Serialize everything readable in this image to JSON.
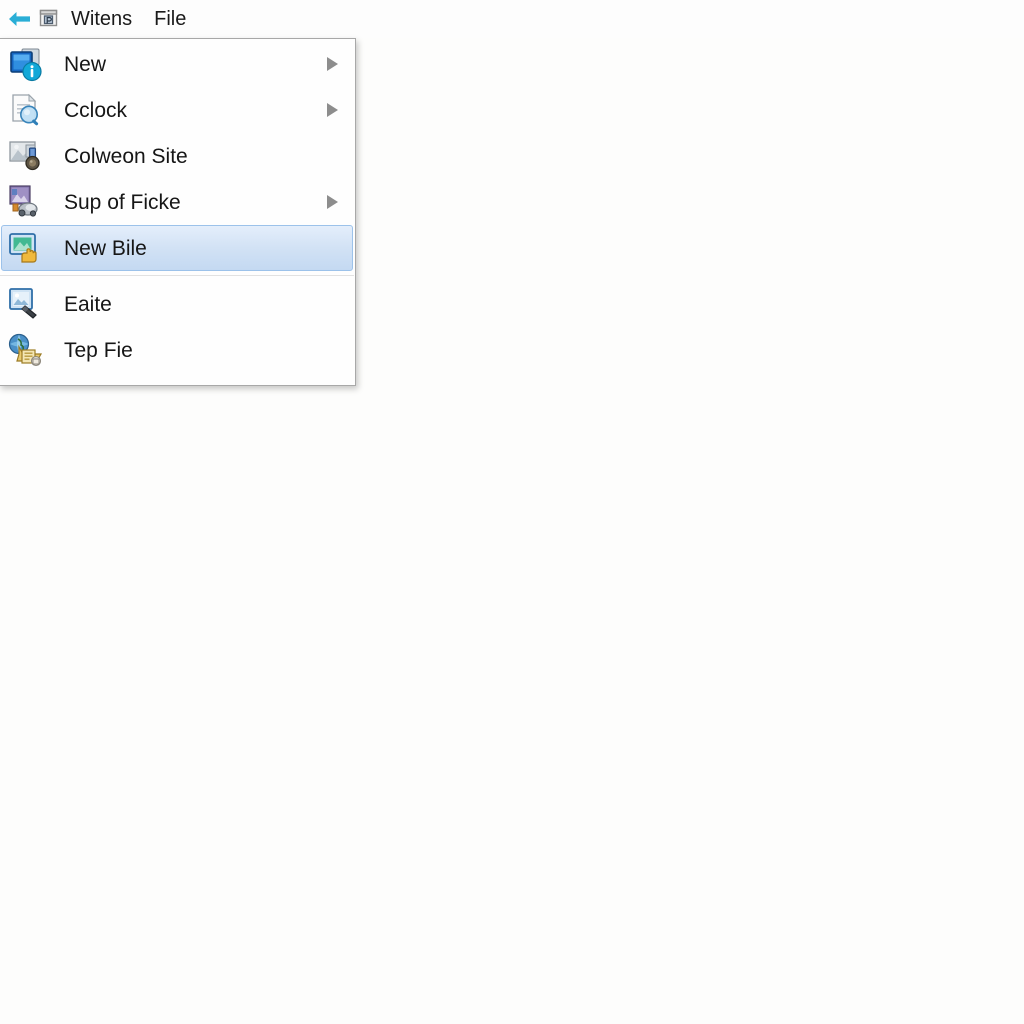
{
  "header": {
    "back_icon": "back-arrow-icon",
    "app_icon": "window-frame-icon",
    "title": "Witens",
    "menu_file": "File"
  },
  "context_menu": {
    "sections": [
      {
        "items": [
          {
            "label": "New",
            "icon": "new-window-info-icon",
            "has_submenu": true,
            "selected": false
          },
          {
            "label": "Cclock",
            "icon": "document-search-icon",
            "has_submenu": true,
            "selected": false
          },
          {
            "label": "Colweon Site",
            "icon": "image-medal-icon",
            "has_submenu": false,
            "selected": false
          },
          {
            "label": "Sup of Ficke",
            "icon": "picture-printer-icon",
            "has_submenu": true,
            "selected": false
          },
          {
            "label": "New Bile",
            "icon": "screen-hand-icon",
            "has_submenu": false,
            "selected": true
          }
        ]
      },
      {
        "items": [
          {
            "label": "Eaite",
            "icon": "photo-card-icon",
            "has_submenu": false,
            "selected": false
          },
          {
            "label": "Tep Fie",
            "icon": "globe-folder-icon",
            "has_submenu": false,
            "selected": false
          }
        ]
      }
    ]
  },
  "colors": {
    "page_background": "#fdfdfc",
    "menu_background": "#fefefe",
    "menu_border": "#a8a8a8",
    "selection_fill": "#d2e2f5",
    "selection_border": "#9cc2ea",
    "text": "#161616",
    "arrow": "#8d8d8d",
    "back_arrow": "#2aaed6"
  }
}
